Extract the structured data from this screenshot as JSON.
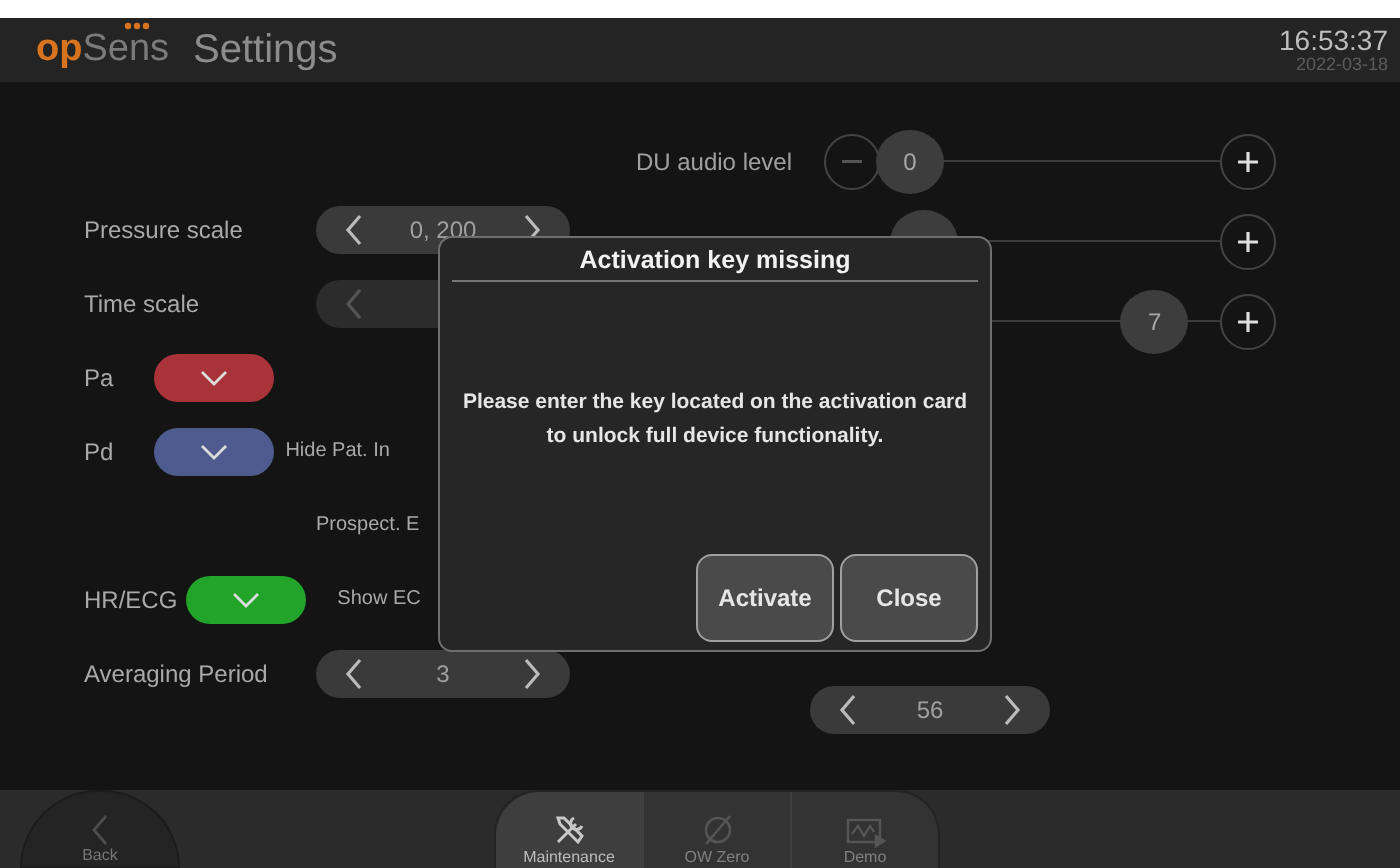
{
  "header": {
    "logo_accent": "op",
    "logo_rest": "Sens",
    "title": "Settings",
    "time": "16:53:37",
    "date": "2022-03-18"
  },
  "left_rows": [
    {
      "kind": "stepper",
      "label": "Pressure scale",
      "value": "0, 200",
      "disabled": false
    },
    {
      "kind": "stepper",
      "label": "Time scale",
      "disabled": true
    },
    {
      "kind": "color",
      "label": "Pa",
      "color": "#a8343a"
    },
    {
      "kind": "color",
      "label": "Pd",
      "color": "#4f5b8e",
      "side": "Hide Pat. In"
    },
    {
      "kind": "text",
      "side": "Prospect. E"
    },
    {
      "kind": "color",
      "label": "HR/ECG",
      "color": "#22a32a",
      "side": "Show EC"
    },
    {
      "kind": "stepper",
      "label": "Averaging Period",
      "value": "3",
      "disabled": false
    }
  ],
  "sliders": [
    {
      "label": "DU audio level",
      "value": "0",
      "level": 0
    },
    {
      "level": 0.05
    },
    {
      "value": "7",
      "level": 0.9
    }
  ],
  "extra_stepper": {
    "value": "56"
  },
  "dialog": {
    "title": "Activation key missing",
    "message": "Please enter the key located on the activation card to unlock full device functionality.",
    "buttons": [
      "Activate",
      "Close"
    ]
  },
  "nav": {
    "back": "Back",
    "tabs": [
      {
        "kind": "tools",
        "label": "Maintenance",
        "selected": true
      },
      {
        "kind": "zero",
        "label": "OW Zero",
        "selected": false
      },
      {
        "kind": "demo",
        "label": "Demo",
        "selected": false
      }
    ]
  }
}
